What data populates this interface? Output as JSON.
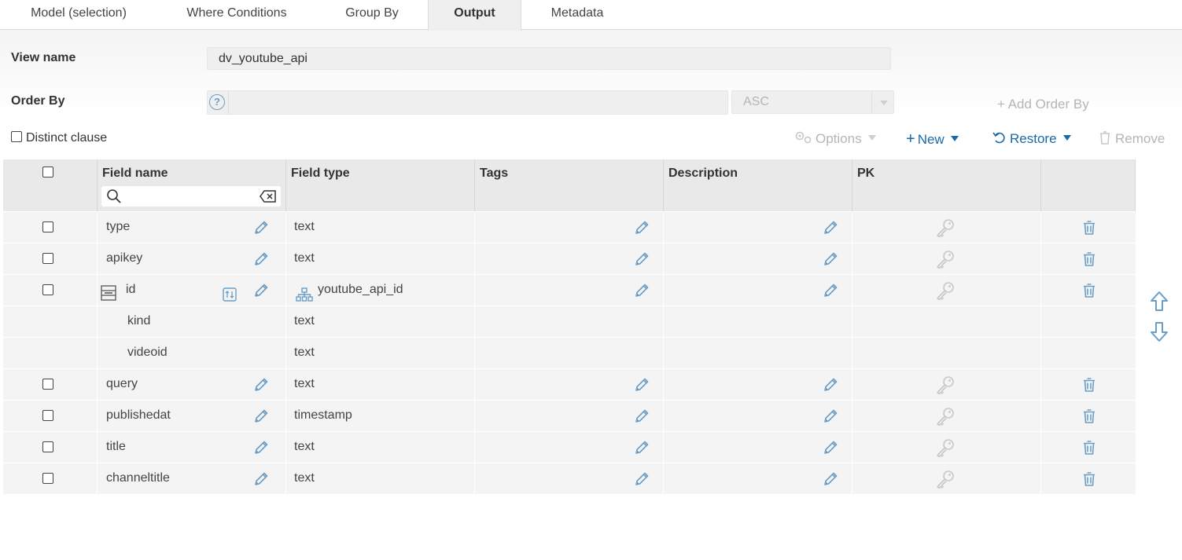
{
  "tabs": [
    {
      "label": "Model (selection)",
      "active": false
    },
    {
      "label": "Where Conditions",
      "active": false
    },
    {
      "label": "Group By",
      "active": false
    },
    {
      "label": "Output",
      "active": true
    },
    {
      "label": "Metadata",
      "active": false
    }
  ],
  "form": {
    "view_name_label": "View name",
    "view_name_value": "dv_youtube_api",
    "order_by_label": "Order By",
    "order_by_value": "",
    "order_direction": "ASC",
    "add_order_by": "+ Add Order By"
  },
  "toolbar": {
    "distinct_label": "Distinct clause",
    "options_label": "Options",
    "new_label": "New",
    "restore_label": "Restore",
    "remove_label": "Remove"
  },
  "table": {
    "headers": {
      "field_name": "Field name",
      "field_type": "Field type",
      "tags": "Tags",
      "description": "Description",
      "pk": "PK"
    },
    "search_value": "",
    "rows": [
      {
        "name": "type",
        "type": "text"
      },
      {
        "name": "apikey",
        "type": "text"
      },
      {
        "name": "id",
        "type": "youtube_api_id"
      },
      {
        "name": "kind",
        "type": "text"
      },
      {
        "name": "videoid",
        "type": "text"
      },
      {
        "name": "query",
        "type": "text"
      },
      {
        "name": "publishedat",
        "type": "timestamp"
      },
      {
        "name": "title",
        "type": "text"
      },
      {
        "name": "channeltitle",
        "type": "text"
      }
    ]
  },
  "colors": {
    "accent": "#1a6aa6",
    "icon": "#6a9ec7",
    "disabled": "#b5b5b5"
  }
}
